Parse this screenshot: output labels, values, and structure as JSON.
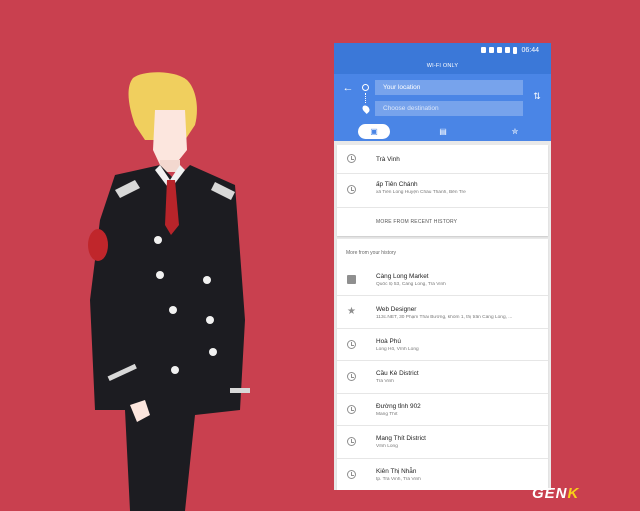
{
  "status_bar": {
    "time": "06:44"
  },
  "wifi_banner": "WI-FI ONLY",
  "directions": {
    "origin_text": "Your location",
    "destination_placeholder": "Choose destination"
  },
  "icons": {
    "back": "arrow-back",
    "swap": "swap-vertical",
    "car": "car",
    "transit": "train",
    "walk": "walk",
    "history_row": "clock",
    "saved_star": "star",
    "flag": "flag"
  },
  "recent": {
    "items": [
      {
        "title": "Trà Vinh",
        "subtitle": ""
      },
      {
        "title": "ấp Tiên Chánh",
        "subtitle": "xã Tiên Long Huyện Châu Thành, Bến Tre"
      }
    ],
    "more_label": "MORE FROM RECENT HISTORY"
  },
  "history": {
    "header": "More from your history",
    "items": [
      {
        "title": "Càng Long Market",
        "subtitle": "Quốc lộ 53, Càng Long, Trà Vinh"
      },
      {
        "title": "Web Designer",
        "subtitle": "113c.NET, 30 Phạm Thái Bường, khóm 1, thị trấn Càng Long, ..."
      },
      {
        "title": "Hoà Phú",
        "subtitle": "Long Hồ, Vĩnh Long"
      },
      {
        "title": "Cầu Kè District",
        "subtitle": "Trà Vinh"
      },
      {
        "title": "Đường tỉnh 902",
        "subtitle": "Mang Thít"
      },
      {
        "title": "Mang Thít District",
        "subtitle": "Vĩnh Long"
      },
      {
        "title": "Kiên Thị Nhẫn",
        "subtitle": "tp. Trà Vinh, Trà Vinh"
      }
    ]
  },
  "watermark": {
    "text_main": "GEN",
    "text_accent": "K"
  },
  "colors": {
    "background": "#c9404f",
    "header_blue": "#4a85e6",
    "status_blue": "#3b78d8"
  }
}
